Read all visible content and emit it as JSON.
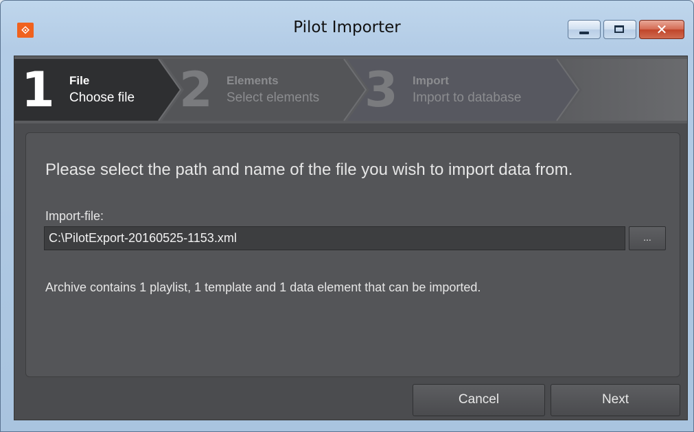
{
  "window": {
    "title": "Pilot Importer",
    "close_glyph": "✕",
    "accent_color": "#f0621e"
  },
  "app_icon": {
    "name": "pilot-logo-icon",
    "glyph": "⟐"
  },
  "steps": [
    {
      "number": "1",
      "title": "File",
      "subtitle": "Choose file",
      "active": true
    },
    {
      "number": "2",
      "title": "Elements",
      "subtitle": "Select elements",
      "active": false
    },
    {
      "number": "3",
      "title": "Import",
      "subtitle": "Import to database",
      "active": false
    }
  ],
  "main": {
    "instruction": "Please select the path and name of the file you wish to import data from.",
    "import_file_label": "Import-file:",
    "import_file_value": "C:\\PilotExport-20160525-1153.xml",
    "browse_label": "...",
    "archive_info": "Archive contains 1 playlist, 1 template and 1 data element that can be imported."
  },
  "footer": {
    "cancel_label": "Cancel",
    "next_label": "Next"
  }
}
